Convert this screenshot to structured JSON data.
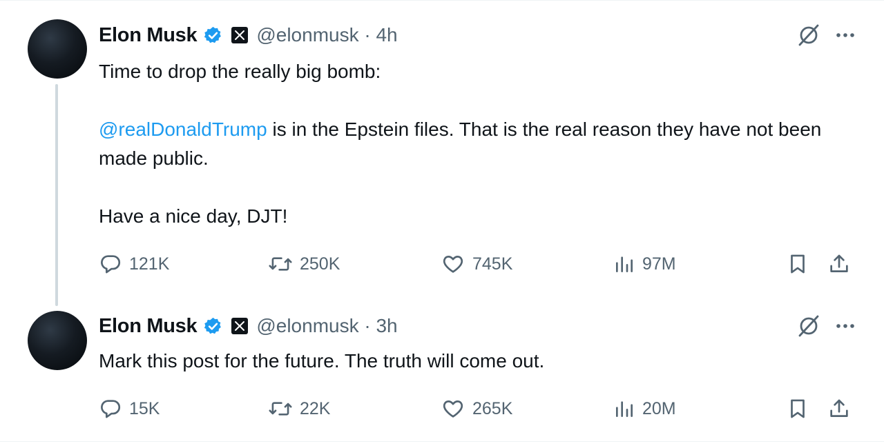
{
  "tweets": [
    {
      "author": {
        "name": "Elon Musk",
        "handle": "@elonmusk",
        "time": "4h"
      },
      "text": {
        "line1": "Time to drop the really big bomb:",
        "mention": "@realDonaldTrump",
        "line2": " is in the Epstein files. That is the real reason they have not been made public.",
        "line3": "Have a nice day, DJT!"
      },
      "stats": {
        "replies": "121K",
        "reposts": "250K",
        "likes": "745K",
        "views": "97M"
      }
    },
    {
      "author": {
        "name": "Elon Musk",
        "handle": "@elonmusk",
        "time": "3h"
      },
      "text": {
        "line1": "Mark this post for the future. The truth will come out."
      },
      "stats": {
        "replies": "15K",
        "reposts": "22K",
        "likes": "265K",
        "views": "20M"
      }
    }
  ],
  "separator": " · ",
  "colors": {
    "accent": "#1d9bf0",
    "text": "#0f1419",
    "muted": "#536471",
    "line": "#cfd9de"
  },
  "icons": [
    "verified-badge-icon",
    "x-logo-icon",
    "grok-icon",
    "more-icon",
    "reply-icon",
    "repost-icon",
    "like-icon",
    "views-icon",
    "bookmark-icon",
    "share-icon"
  ]
}
